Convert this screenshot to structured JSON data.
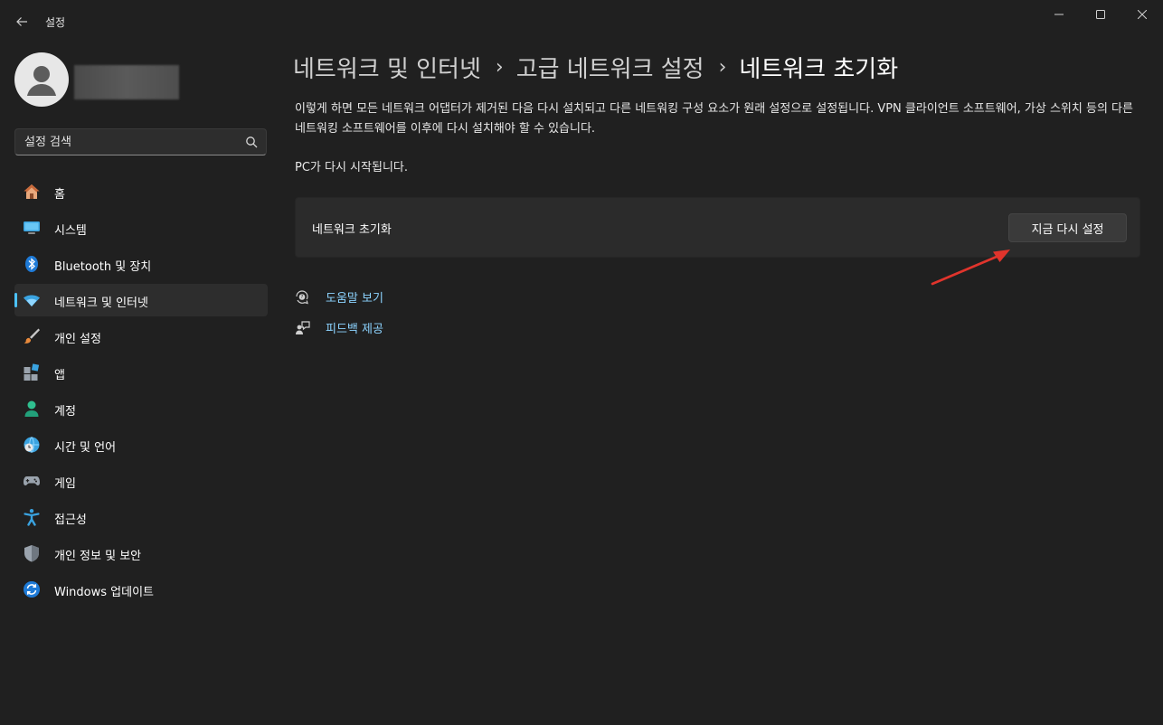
{
  "titlebar": {
    "app_title": "설정",
    "back_icon": "arrow-left-icon",
    "minimize_icon": "minimize-icon",
    "maximize_icon": "maximize-icon",
    "close_icon": "close-icon"
  },
  "sidebar": {
    "search": {
      "placeholder": "설정 검색"
    },
    "items": [
      {
        "label": "홈",
        "icon": "home-icon"
      },
      {
        "label": "시스템",
        "icon": "monitor-icon"
      },
      {
        "label": "Bluetooth 및 장치",
        "icon": "bluetooth-icon"
      },
      {
        "label": "네트워크 및 인터넷",
        "icon": "wifi-icon",
        "active": true
      },
      {
        "label": "개인 설정",
        "icon": "paintbrush-icon"
      },
      {
        "label": "앱",
        "icon": "apps-icon"
      },
      {
        "label": "계정",
        "icon": "person-icon"
      },
      {
        "label": "시간 및 언어",
        "icon": "globe-clock-icon"
      },
      {
        "label": "게임",
        "icon": "gamepad-icon"
      },
      {
        "label": "접근성",
        "icon": "accessibility-icon"
      },
      {
        "label": "개인 정보 및 보안",
        "icon": "shield-icon"
      },
      {
        "label": "Windows 업데이트",
        "icon": "refresh-icon"
      }
    ]
  },
  "main": {
    "breadcrumb": [
      "네트워크 및 인터넷",
      "고급 네트워크 설정",
      "네트워크 초기화"
    ],
    "description": "이렇게 하면 모든 네트워크 어댑터가 제거된 다음 다시 설치되고 다른 네트워킹 구성 요소가 원래 설정으로 설정됩니다. VPN 클라이언트 소프트웨어, 가상 스위치 등의 다른 네트워킹 소프트웨어를 이후에 다시 설치해야 할 수 있습니다.",
    "restart_note": "PC가 다시 시작됩니다.",
    "reset_card": {
      "label": "네트워크 초기화",
      "button_label": "지금 다시 설정"
    },
    "links": {
      "help": "도움말 보기",
      "feedback": "피드백 제공"
    }
  },
  "colors": {
    "background": "#202020",
    "accent": "#4cc2ff",
    "link": "#8cd3ff",
    "annotation_arrow": "#e0342c"
  }
}
